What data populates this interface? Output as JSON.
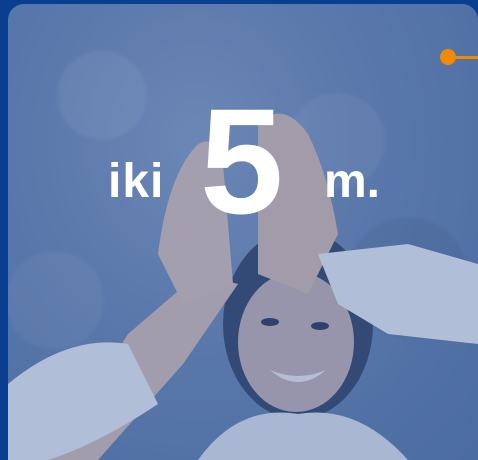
{
  "headline": {
    "prefix": "iki",
    "number": "5",
    "suffix": "m."
  },
  "colors": {
    "background": "#0b3f8f",
    "accent": "#f28a00",
    "text": "#ffffff"
  },
  "icons": {
    "accent_marker": "orange-dot-connector-icon"
  }
}
